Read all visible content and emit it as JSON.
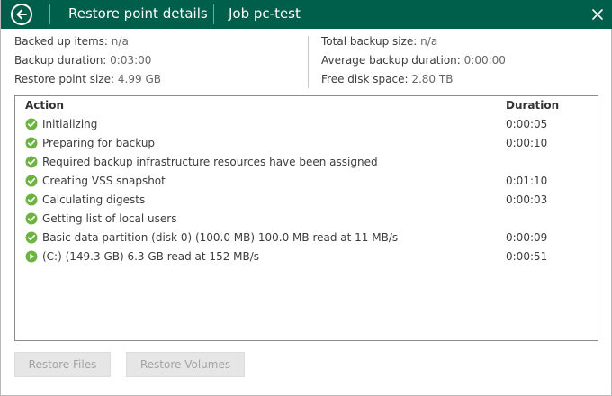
{
  "titlebar": {
    "title": "Restore point details",
    "job": "Job pc-test"
  },
  "summary": {
    "left": [
      {
        "label": "Backed up items:",
        "value": "n/a"
      },
      {
        "label": "Backup duration:",
        "value": "0:03:00"
      },
      {
        "label": "Restore point size:",
        "value": "4.99 GB"
      }
    ],
    "right": [
      {
        "label": "Total backup size:",
        "value": "n/a"
      },
      {
        "label": "Average backup duration:",
        "value": "0:00:00"
      },
      {
        "label": "Free disk space:",
        "value": "2.80 TB"
      }
    ]
  },
  "log": {
    "headers": {
      "action": "Action",
      "duration": "Duration"
    },
    "rows": [
      {
        "status": "success",
        "icon": "check-circle-icon",
        "action": "Initializing",
        "duration": "0:00:05"
      },
      {
        "status": "success",
        "icon": "check-circle-icon",
        "action": "Preparing for backup",
        "duration": "0:00:10"
      },
      {
        "status": "success",
        "icon": "check-circle-icon",
        "action": "Required backup infrastructure resources have been assigned",
        "duration": ""
      },
      {
        "status": "success",
        "icon": "check-circle-icon",
        "action": "Creating VSS snapshot",
        "duration": "0:01:10"
      },
      {
        "status": "success",
        "icon": "check-circle-icon",
        "action": "Calculating digests",
        "duration": "0:00:03"
      },
      {
        "status": "success",
        "icon": "check-circle-icon",
        "action": "Getting list of local users",
        "duration": ""
      },
      {
        "status": "success",
        "icon": "check-circle-icon",
        "action": "Basic data partition (disk 0) (100.0 MB) 100.0 MB read at 11 MB/s",
        "duration": "0:00:09"
      },
      {
        "status": "running",
        "icon": "play-circle-icon",
        "action": "(C:) (149.3 GB) 6.3 GB read at 152 MB/s",
        "duration": "0:00:51"
      }
    ]
  },
  "buttons": {
    "restore_files": "Restore Files",
    "restore_volumes": "Restore Volumes"
  },
  "colors": {
    "titlebar": "#005f4b",
    "success": "#6db33f",
    "disabled_text": "#a3a3a3"
  }
}
